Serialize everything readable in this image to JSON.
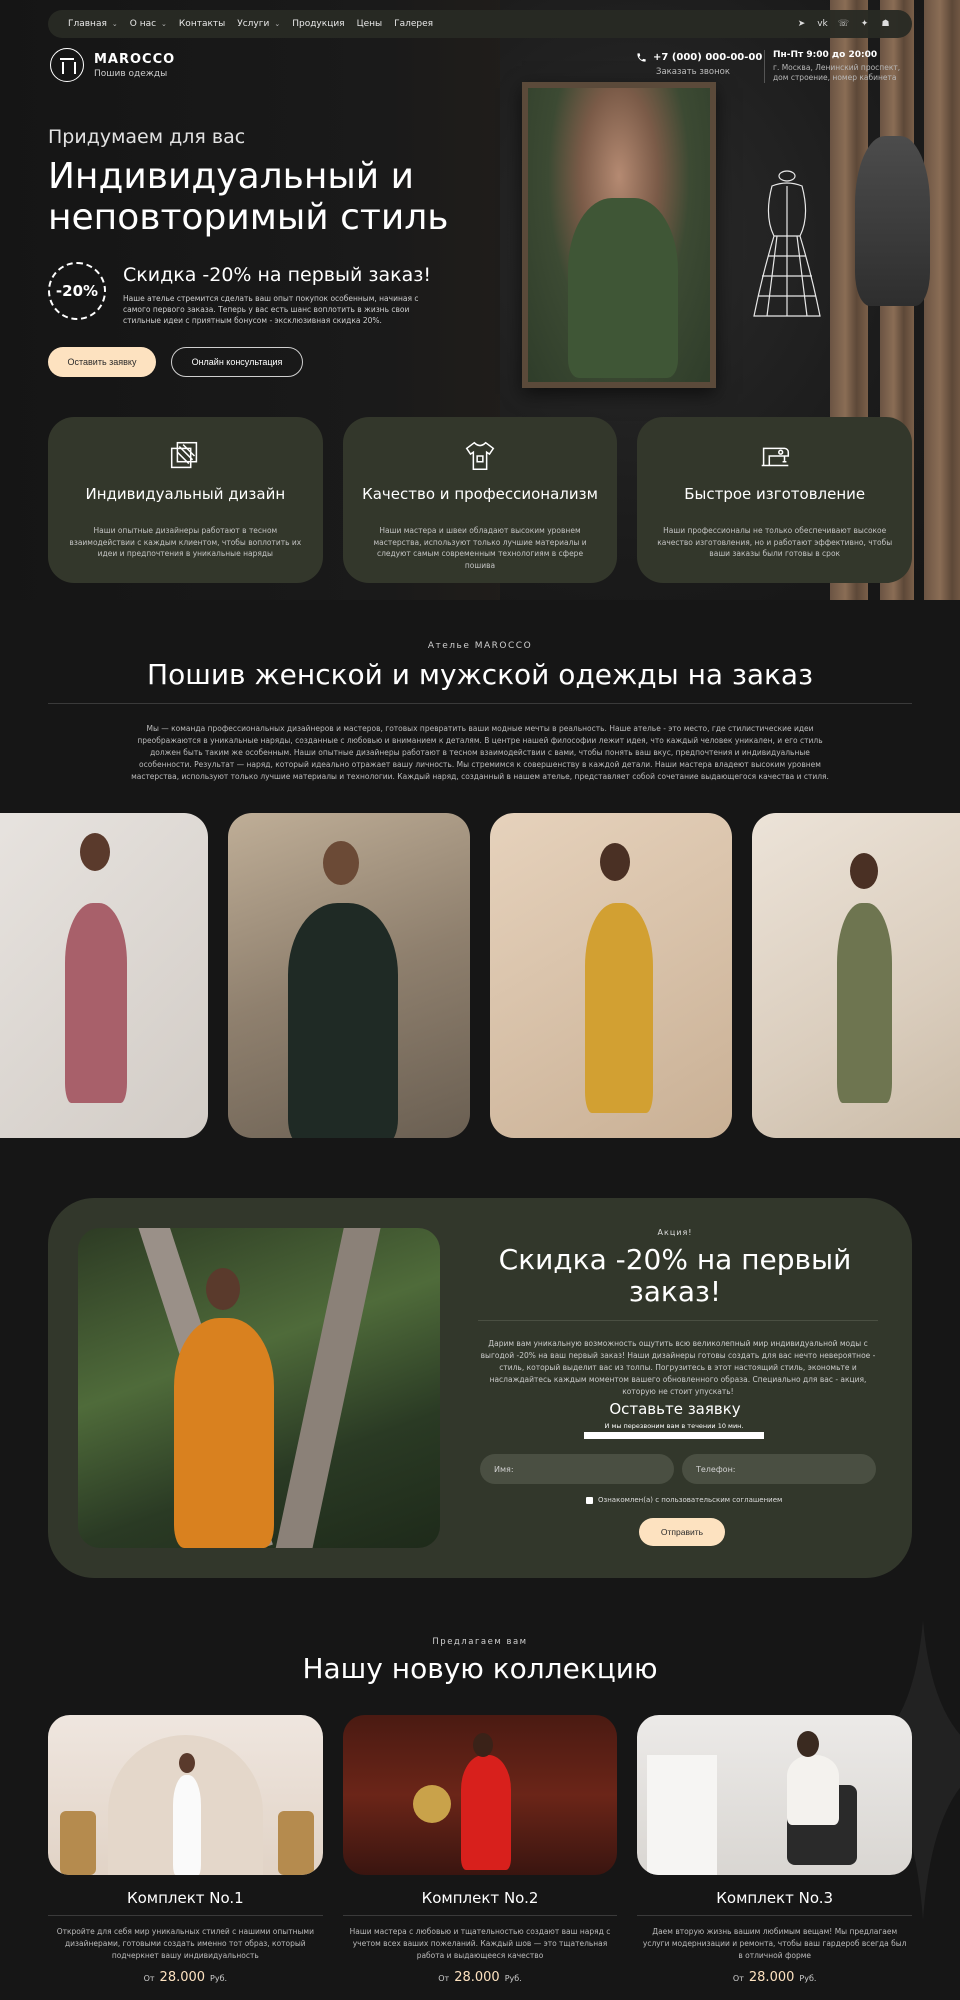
{
  "nav": {
    "items": [
      {
        "label": "Главная",
        "dropdown": true
      },
      {
        "label": "О нас",
        "dropdown": true
      },
      {
        "label": "Контакты",
        "dropdown": false
      },
      {
        "label": "Услуги",
        "dropdown": true
      },
      {
        "label": "Продукция",
        "dropdown": false
      },
      {
        "label": "Цены",
        "dropdown": false
      },
      {
        "label": "Галерея",
        "dropdown": false
      }
    ],
    "socials": [
      "telegram-icon",
      "vk-icon",
      "whatsapp-icon",
      "twitter-icon",
      "snapchat-icon"
    ]
  },
  "brand": {
    "name": "MAROCCO",
    "tagline": "Пошив одежды"
  },
  "contact": {
    "phone": "+7 (000) 000-00-00",
    "callback": "Заказать звонок",
    "hours": "Пн-Пт 9:00 до 20:00",
    "address": "г. Москва, Ленинский проспект, дом строение, номер кабинета"
  },
  "hero": {
    "pretitle": "Придумаем для вас",
    "title": "Индивидуальный и неповторимый стиль",
    "badge": "-20%",
    "promo_title": "Скидка -20% на первый заказ!",
    "promo_text": "Наше ателье стремится сделать ваш опыт покупок особенным, начиная с самого первого заказа. Теперь у вас есть шанс воплотить в жизнь свои стильные идеи с приятным бонусом - эксклюзивная скидка 20%.",
    "btn_primary": "Оставить заявку",
    "btn_secondary": "Онлайн консультация"
  },
  "features": [
    {
      "icon": "fabric-icon",
      "title": "Индивидуальный дизайн",
      "text": "Наши опытные дизайнеры работают в тесном взаимодействии с каждым клиентом, чтобы воплотить их идеи и предпочтения в уникальные наряды"
    },
    {
      "icon": "shirt-icon",
      "title": "Качество и профессионализм",
      "text": "Наши мастера и швеи обладают высоким уровнем мастерства, используют только лучшие материалы и следуют самым современным технологиям в сфере пошива"
    },
    {
      "icon": "sewing-machine-icon",
      "title": "Быстрое изготовление",
      "text": "Наши профессионалы не только обеспечивают высокое качество изготовления, но и работают эффективно, чтобы ваши заказы были готовы в срок"
    }
  ],
  "about": {
    "pretitle": "Ателье MAROCCO",
    "title": "Пошив женской и мужской одежды на заказ",
    "text": "Мы — команда профессиональных дизайнеров и мастеров, готовых превратить ваши модные мечты в реальность. Наше ателье - это место, где стилистические идеи преображаются в уникальные наряды, созданные с любовью и вниманием к деталям. В центре нашей философии лежит идея, что каждый человек уникален, и его стиль должен быть таким же особенным. Наши опытные дизайнеры работают в тесном взаимодействии с вами, чтобы понять ваш вкус, предпочтения и индивидуальные особенности. Результат — наряд, который идеально отражает вашу личность. Мы стремимся к совершенству в каждой детали. Наши мастера владеют высоким уровнем мастерства, используют только лучшие материалы и технологии. Каждый наряд, созданный в нашем ателье, представляет собой сочетание выдающегося качества и стиля."
  },
  "promo": {
    "label": "Акция!",
    "title": "Скидка -20% на первый заказ!",
    "text": "Дарим вам уникальную возможность ощутить всю великолепный мир индивидуальной моды с выгодой -20% на ваш первый заказ! Наши дизайнеры готовы создать для вас нечто невероятное - стиль, который выделит вас из толпы. Погрузитесь в этот настоящий стиль, экономьте и наслаждайтесь каждым моментом вашего обновленного образа. Специально для вас - акция, которую не стоит упускать!",
    "form_title": "Оставьте заявку",
    "form_sub": "И мы перезвоним вам в течении 10 мин.",
    "name_placeholder": "Имя:",
    "phone_placeholder": "Телефон:",
    "agree": "Ознакомлен(а) с пользовательским соглашением",
    "submit": "Отправить"
  },
  "collection": {
    "pretitle": "Предлагаем вам",
    "title": "Нашу новую коллекцию",
    "products": [
      {
        "name": "Комплект No.1",
        "text": "Откройте для себя мир уникальных стилей с нашими опытными дизайнерами, готовыми создать именно тот образ, который подчеркнет вашу индивидуальность",
        "price_from": "От",
        "price": "28.000",
        "currency": "Руб."
      },
      {
        "name": "Комплект No.2",
        "text": "Наши мастера с любовью и тщательностью создают ваш наряд с учетом всех ваших пожеланий. Каждый шов — это тщательная работа и выдающееся качество",
        "price_from": "От",
        "price": "28.000",
        "currency": "Руб."
      },
      {
        "name": "Комплект No.3",
        "text": "Даем вторую жизнь вашим любимым вещам! Мы предлагаем услуги модернизации и ремонта, чтобы ваш гардероб всегда был в отличной форме",
        "price_from": "От",
        "price": "28.000",
        "currency": "Руб."
      }
    ]
  },
  "colors": {
    "accent": "#fde2c0",
    "card": "#33372b",
    "bg": "#161616"
  }
}
